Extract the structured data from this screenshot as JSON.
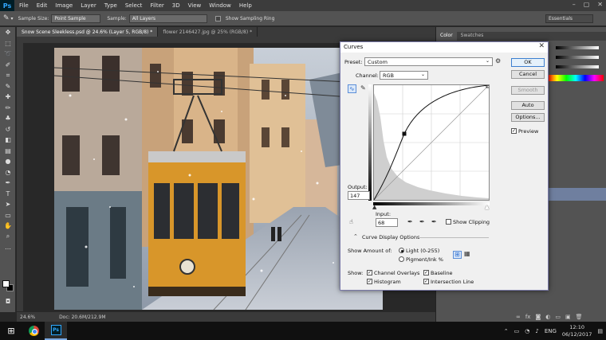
{
  "app": {
    "logo": "Ps",
    "menu": [
      "File",
      "Edit",
      "Image",
      "Layer",
      "Type",
      "Select",
      "Filter",
      "3D",
      "View",
      "Window",
      "Help"
    ]
  },
  "options_bar": {
    "sample_size_label": "Sample Size:",
    "sample_size_value": "Point Sample",
    "sample_label": "Sample:",
    "sample_value": "All Layers",
    "sampling_ring_label": "Show Sampling Ring",
    "workspace": "Essentials"
  },
  "tabs": [
    {
      "label": "Snow Scene Sleekless.psd @ 24.6% (Layer 5, RGB/8) *",
      "active": true
    },
    {
      "label": "flower 2146427.jpg @ 25% (RGB/8) *",
      "active": false
    }
  ],
  "status": {
    "zoom": "24.6%",
    "doc": "Doc: 20.6M/212.9M"
  },
  "panels": {
    "color_tab": "Color",
    "swatches_tab": "Swatches"
  },
  "curves": {
    "title": "Curves",
    "preset_label": "Preset:",
    "preset_value": "Custom",
    "channel_label": "Channel:",
    "channel_value": "RGB",
    "output_label": "Output:",
    "output_value": "147",
    "input_label": "Input:",
    "input_value": "68",
    "show_clipping_label": "Show Clipping",
    "display_options_label": "Curve Display Options",
    "show_amount_label": "Show Amount of:",
    "light_label": "Light  (0-255)",
    "pigment_label": "Pigment/Ink %",
    "show_label": "Show:",
    "channel_overlays_label": "Channel Overlays",
    "baseline_label": "Baseline",
    "histogram_label": "Histogram",
    "intersection_line_label": "Intersection Line",
    "buttons": {
      "ok": "OK",
      "cancel": "Cancel",
      "smooth": "Smooth",
      "auto": "Auto",
      "options": "Options..."
    },
    "preview_label": "Preview",
    "close_glyph": "✕"
  },
  "taskbar": {
    "start_glyph": "⊞",
    "ps_icon": "Ps",
    "language": "ENG",
    "time": "12:10",
    "date": "06/12/2017"
  }
}
